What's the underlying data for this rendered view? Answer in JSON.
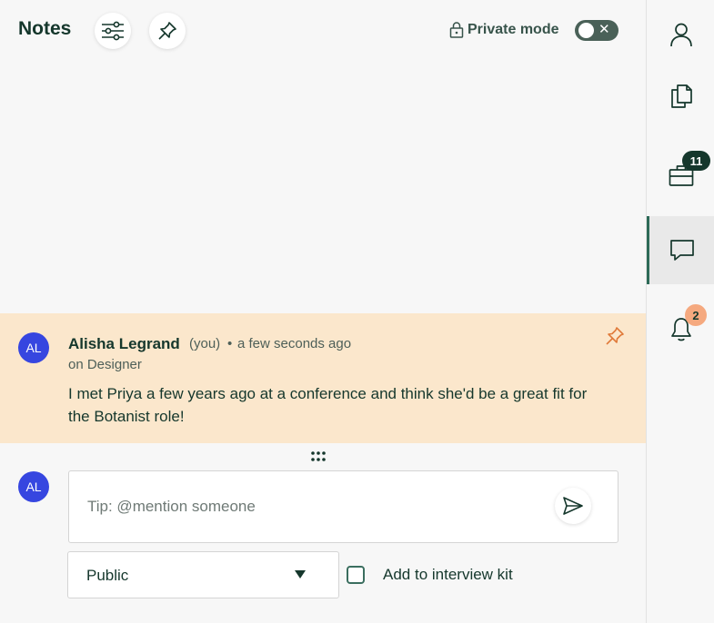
{
  "header": {
    "title": "Notes",
    "private_mode_label": "Private mode",
    "private_mode_on": false
  },
  "note": {
    "avatar_initials": "AL",
    "author": "Alisha Legrand",
    "you_tag": "(you)",
    "separator": "•",
    "timestamp": "a few seconds ago",
    "context": "on Designer",
    "body": "I met Priya a few years ago at a conference and think she'd be a great fit for the Botanist role!",
    "pinned": true
  },
  "composer": {
    "avatar_initials": "AL",
    "placeholder": "Tip: @mention someone",
    "value": "",
    "visibility_selected": "Public",
    "add_to_kit_label": "Add to interview kit",
    "add_to_kit_checked": false
  },
  "rail": {
    "items": [
      {
        "icon": "person-icon",
        "badge": ""
      },
      {
        "icon": "documents-icon",
        "badge": ""
      },
      {
        "icon": "briefcase-icon",
        "badge": "11"
      },
      {
        "icon": "chat-icon",
        "badge": "",
        "active": true
      },
      {
        "icon": "bell-icon",
        "badge": "2"
      }
    ]
  },
  "colors": {
    "brand_dark": "#15372c",
    "note_highlight": "#fbe7cc",
    "avatar": "#3646e0",
    "pin_accent": "#e07a3a",
    "notification_badge": "#f5a97f"
  }
}
